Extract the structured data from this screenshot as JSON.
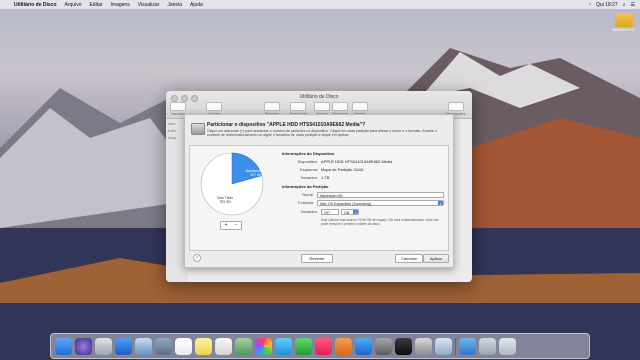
{
  "menubar": {
    "apple": "",
    "items": [
      "Utilitário de Disco",
      "Arquivo",
      "Editar",
      "Imagens",
      "Visualizar",
      "Janela",
      "Ajuda"
    ],
    "clock": "Qui 18:27"
  },
  "desktop_icon": {
    "label": "Macintosh HD"
  },
  "window": {
    "title": "Utilitário de Disco",
    "toolbar": [
      "Visualizar",
      "Volume",
      "Resgatar",
      "Particionar",
      "Apagar",
      "Restaurar",
      "Montar",
      "Informações"
    ],
    "sidebar": [
      "Inter",
      "Exter",
      "Imag"
    ]
  },
  "sheet": {
    "title": "Particionar o dispositivo \"APPLE HDD HTS541010A9E662 Media\"?",
    "desc": "Clique em adicionar (+) para aumentar o número de partições no dispositivo. Clique em cada partição para alterar o nome e o formato. Arraste o controle de redimensionamento ou digite o tamanho de cada partição e clique em Aplicar.",
    "pie": {
      "slice1_label": "Macintosh HD\n207 GB",
      "slice2_label": "Sem Título\n793 GB",
      "slice1_fraction": 0.207,
      "colors": {
        "selected": "#3d8ee8",
        "free": "#ffffff"
      }
    },
    "plus": "+",
    "minus": "−",
    "device_info": {
      "heading": "Informações do Dispositivo",
      "device_key": "Dispositivo:",
      "device_val": "APPLE HDD HTS541010A9E662 Media",
      "scheme_key": "Esquema:",
      "scheme_val": "Mapa de Partição GUID",
      "size_key": "Tamanho:",
      "size_val": "1 TB"
    },
    "partition_info": {
      "heading": "Informações da Partição",
      "name_key": "Nome:",
      "name_val": "Macintosh HD",
      "format_key": "Formato:",
      "format_val": "Mac OS Expandido (Journaling)",
      "size_key": "Tamanho:",
      "size_val": "207",
      "unit": "GB",
      "note": "Este volume está usando 79,99 GB de espaço. Ele será redimensionado. Você não pode remover o primeiro volume do disco."
    },
    "help": "?",
    "buttons": {
      "revert": "Reverter",
      "cancel": "Cancelar",
      "apply": "Aplicar"
    }
  }
}
